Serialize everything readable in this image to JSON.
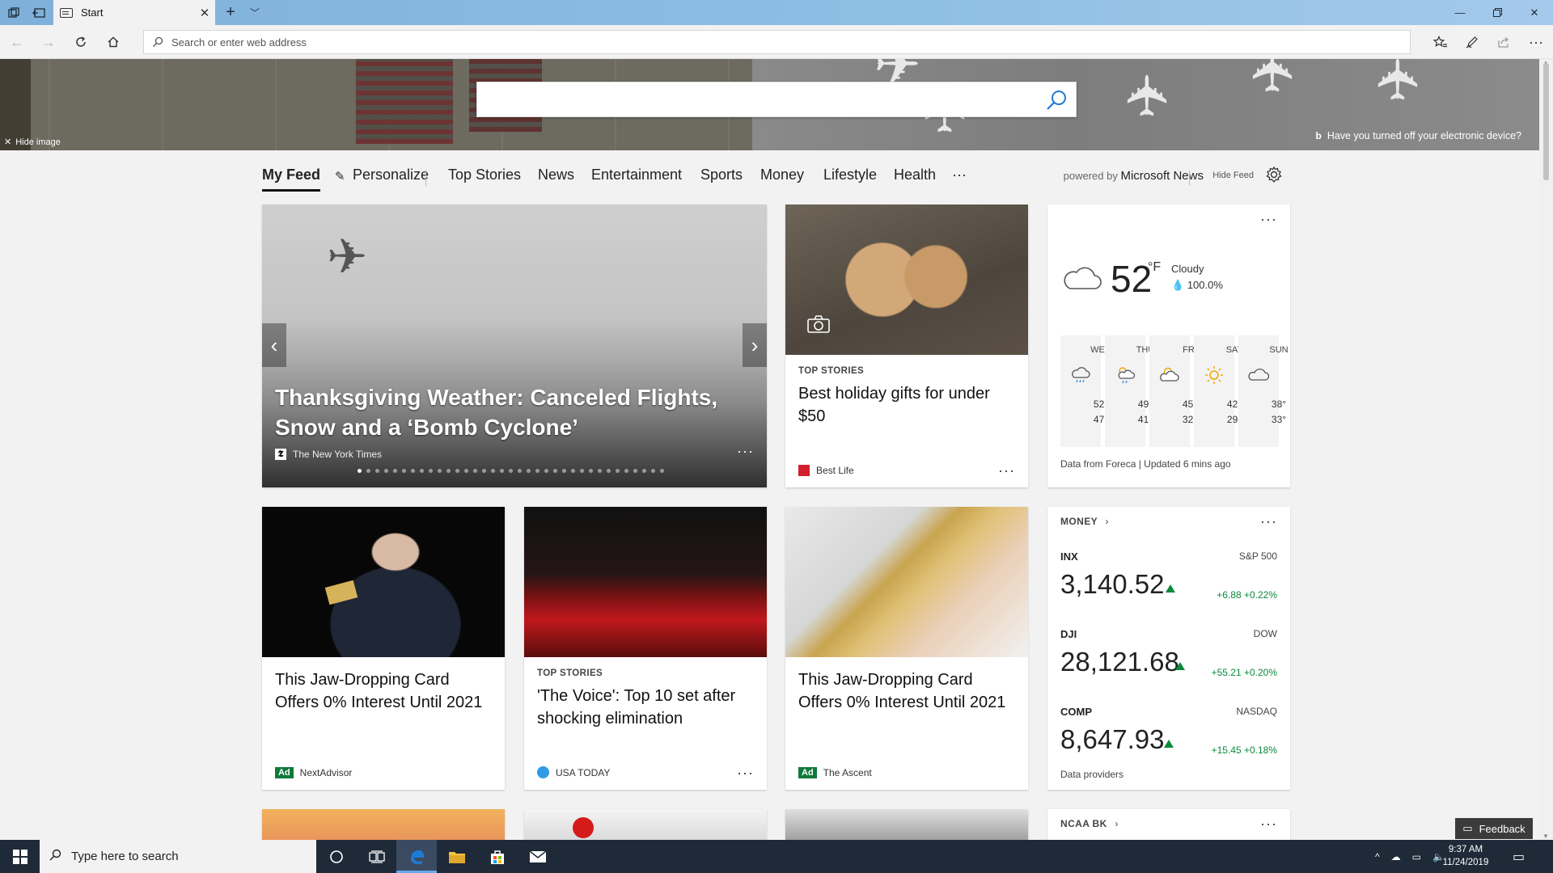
{
  "browser": {
    "tab_title": "Start",
    "address_placeholder": "Search or enter web address"
  },
  "hero": {
    "hide_image": "Hide image",
    "caption": "Have you turned off your electronic device?",
    "search_placeholder": ""
  },
  "feed_nav": {
    "items": [
      "My Feed",
      "Personalize",
      "Top Stories",
      "News",
      "Entertainment",
      "Sports",
      "Money",
      "Lifestyle",
      "Health",
      "···"
    ],
    "powered_by": "powered by",
    "brand": "Microsoft News",
    "hide_feed": "Hide Feed"
  },
  "cards": {
    "hero_story": {
      "title": "Thanksgiving Weather: Canceled Flights, Snow and a ‘Bomb Cyclone’",
      "source": "The New York Times",
      "source_logo": "𝕿"
    },
    "gifts": {
      "kicker": "TOP STORIES",
      "title": "Best holiday gifts for under $50",
      "source": "Best Life"
    },
    "card_ad_1": {
      "title": "This Jaw-Dropping Card Offers 0% Interest Until 2021",
      "ad": "Ad",
      "source": "NextAdvisor"
    },
    "voice": {
      "kicker": "TOP STORIES",
      "title": "'The Voice': Top 10 set after shocking elimination",
      "source": "USA TODAY"
    },
    "card_ad_2": {
      "title": "This Jaw-Dropping Card Offers 0% Interest Until 2021",
      "ad": "Ad",
      "source": "The Ascent"
    },
    "more": "···"
  },
  "weather": {
    "temp": "52",
    "unit": "°F",
    "condition": "Cloudy",
    "precip": "100.0%",
    "days": [
      {
        "day": "WED",
        "hi": "52°",
        "lo": "47°",
        "icon": "rain-cloud-icon"
      },
      {
        "day": "THU",
        "hi": "49°",
        "lo": "41°",
        "icon": "sun-rain-icon"
      },
      {
        "day": "FRI",
        "hi": "45°",
        "lo": "32°",
        "icon": "partly-cloudy-icon"
      },
      {
        "day": "SAT",
        "hi": "42°",
        "lo": "29°",
        "icon": "sun-icon"
      },
      {
        "day": "SUN",
        "hi": "38°",
        "lo": "33°",
        "icon": "cloud-icon"
      }
    ],
    "footer": "Data from Foreca | Updated 6 mins ago"
  },
  "money": {
    "header": "MONEY",
    "stocks": [
      {
        "symbol": "INX",
        "name": "S&P 500",
        "value": "3,140.52",
        "change": "+6.88 +0.22%"
      },
      {
        "symbol": "DJI",
        "name": "DOW",
        "value": "28,121.68",
        "change": "+55.21 +0.20%"
      },
      {
        "symbol": "COMP",
        "name": "NASDAQ",
        "value": "8,647.93",
        "change": "+15.45 +0.18%"
      }
    ],
    "footer": "Data providers"
  },
  "ncaa": {
    "header": "NCAA BK"
  },
  "feedback": "Feedback",
  "taskbar": {
    "search_placeholder": "Type here to search",
    "time": "9:37 AM",
    "date": "11/24/2019"
  },
  "colors": {
    "accent": "#0a8a3a",
    "ad_badge": "#0f7b3b",
    "taskbar": "#1f2a38",
    "edge_blue": "#1e7ad4"
  }
}
